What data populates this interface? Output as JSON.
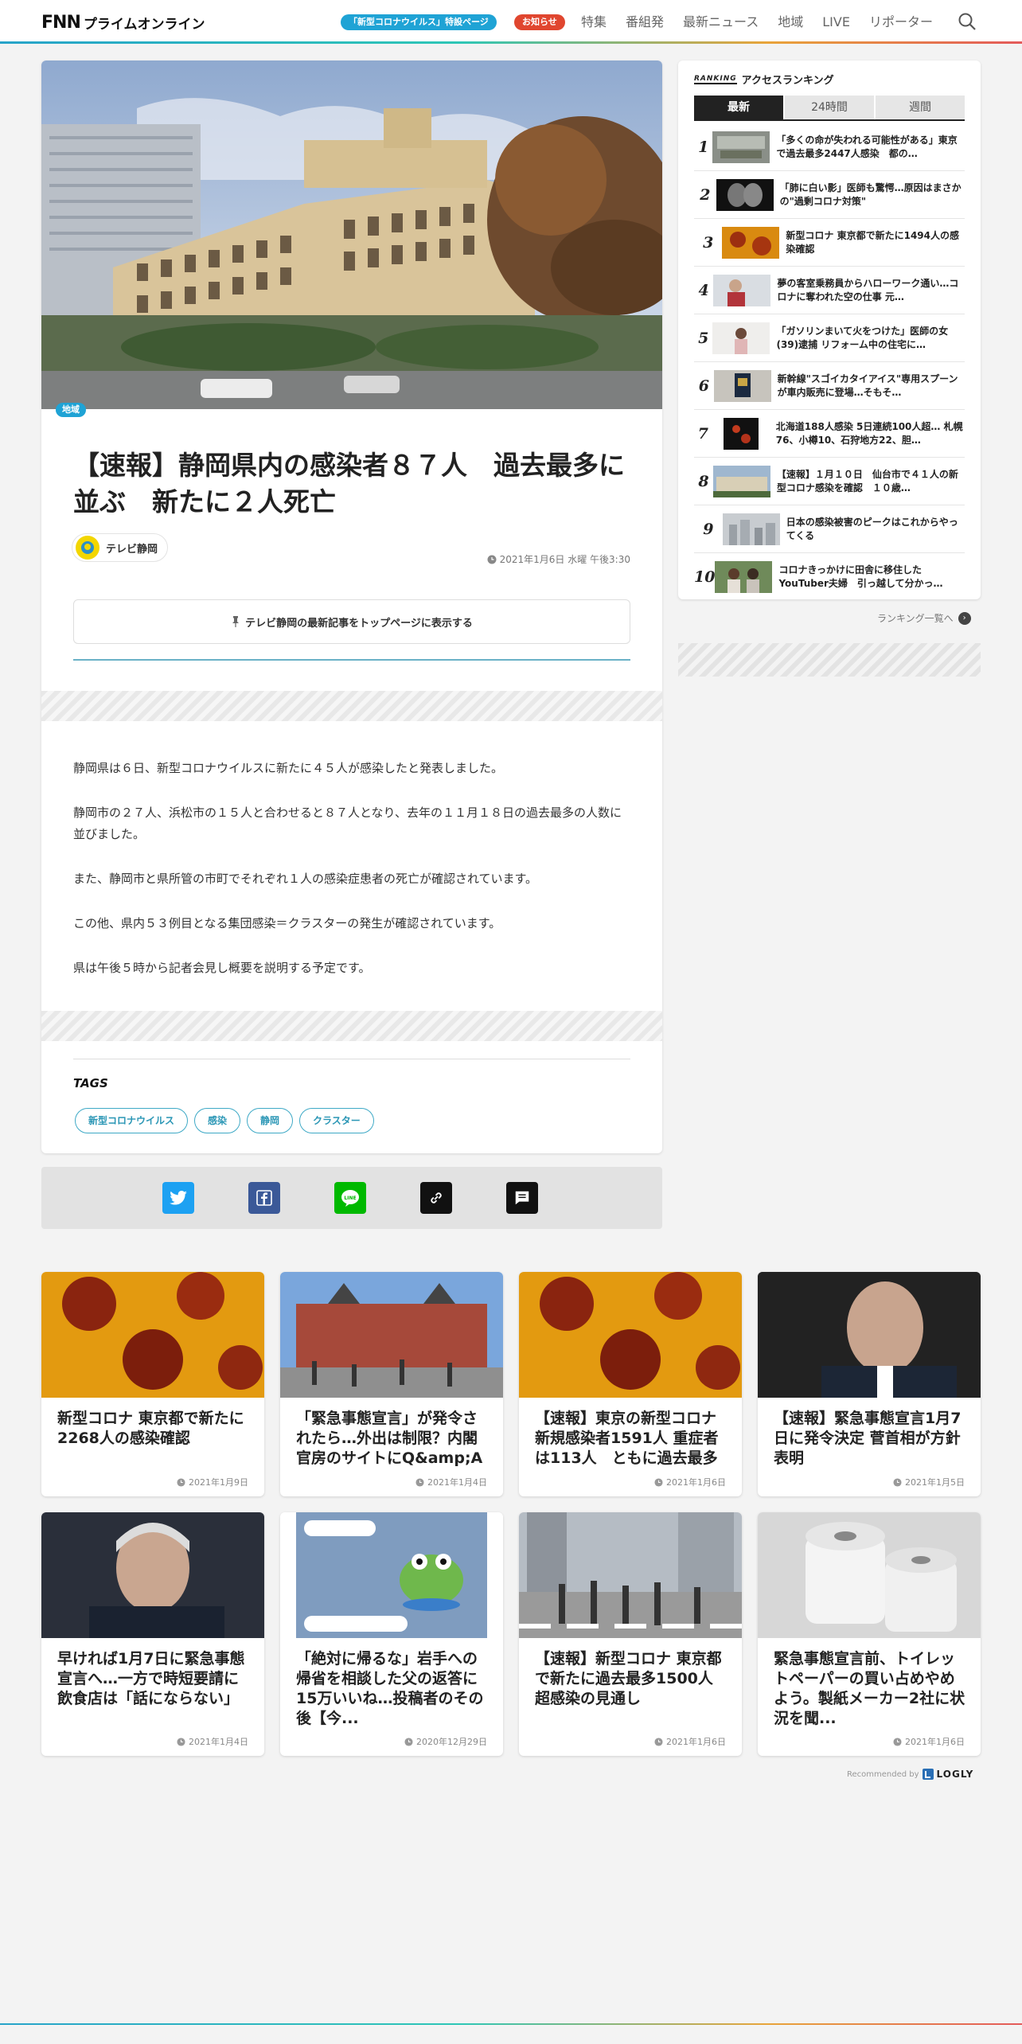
{
  "header": {
    "logo_fnn": "FNN",
    "logo_prime": "プライムオンライン",
    "corona_pill": "「新型コロナウイルス」特設ページ",
    "news_pill": "お知らせ",
    "nav": [
      "特集",
      "番組発",
      "最新ニュース",
      "地域",
      "LIVE",
      "リポーター"
    ]
  },
  "article": {
    "category": "地域",
    "title": "【速報】静岡県内の感染者８７人　過去最多に並ぶ　新たに２人死亡",
    "source": "テレビ静岡",
    "date": "2021年1月6日 水曜 午後3:30",
    "follow_label": "テレビ静岡の最新記事をトップページに表示する",
    "paragraphs": [
      "静岡県は６日、新型コロナウイルスに新たに４５人が感染したと発表しました。",
      "静岡市の２７人、浜松市の１５人と合わせると８７人となり、去年の１１月１８日の過去最多の人数に並びました。",
      "また、静岡市と県所管の市町でそれぞれ１人の感染症患者の死亡が確認されています。",
      "この他、県内５３例目となる集団感染＝クラスターの発生が確認されています。",
      "県は午後５時から記者会見し概要を説明する予定です。"
    ],
    "tags_title": "TAGS",
    "tags": [
      "新型コロナウイルス",
      "感染",
      "静岡",
      "クラスター"
    ]
  },
  "share": [
    "twitter-icon",
    "facebook-icon",
    "line-icon",
    "link-icon",
    "comment-icon"
  ],
  "ranking": {
    "badge": "RANKING",
    "title": "アクセスランキング",
    "tabs": [
      "最新",
      "24時間",
      "週間"
    ],
    "items": [
      {
        "num": "1",
        "text": "「多くの命が失われる可能性がある」東京で過去最多2447人感染　都の…"
      },
      {
        "num": "2",
        "text": "「肺に白い影」医師も驚愕…原因はまさかの\"過剰コロナ対策\""
      },
      {
        "num": "3",
        "text": "新型コロナ 東京都で新たに1494人の感染確認"
      },
      {
        "num": "4",
        "text": "夢の客室乗務員からハローワーク通い…コロナに奪われた空の仕事 元…"
      },
      {
        "num": "5",
        "text": "「ガソリンまいて火をつけた」医師の女(39)逮捕 リフォーム中の住宅に…"
      },
      {
        "num": "6",
        "text": "新幹線\"スゴイカタイアイス\"専用スプーンが車内販売に登場…そもそ…"
      },
      {
        "num": "7",
        "text": "北海道188人感染 5日連続100人超… 札幌76、小樽10、石狩地方22、胆…"
      },
      {
        "num": "8",
        "text": "【速報】１月１０日　仙台市で４１人の新型コロナ感染を確認　１０歳…"
      },
      {
        "num": "9",
        "text": "日本の感染被害のピークはこれからやってくる"
      },
      {
        "num": "10",
        "text": "コロナきっかけに田舎に移住した YouTuber夫婦　引っ越して分かっ…"
      }
    ],
    "more": "ランキング一覧へ"
  },
  "recommend": {
    "cards": [
      {
        "title": "新型コロナ 東京都で新たに2268人の感染確認",
        "date": "2021年1月9日"
      },
      {
        "title": "「緊急事態宣言」が発令されたら…外出は制限？内閣官房のサイトにQ&amp;A",
        "date": "2021年1月4日"
      },
      {
        "title": "【速報】東京の新型コロナ新規感染者1591人 重症者は113人　ともに過去最多",
        "date": "2021年1月6日"
      },
      {
        "title": "【速報】緊急事態宣言1月7日に発令決定 菅首相が方針表明",
        "date": "2021年1月5日"
      },
      {
        "title": "早ければ1月7日に緊急事態宣言へ…一方で時短要請に飲食店は「話にならない」",
        "date": "2021年1月4日"
      },
      {
        "title": "「絶対に帰るな」岩手への帰省を相談した父の返答に15万いいね…投稿者のその後【今...",
        "date": "2020年12月29日"
      },
      {
        "title": "【速報】新型コロナ 東京都で新たに過去最多1500人超感染の見通し",
        "date": "2021年1月6日"
      },
      {
        "title": "緊急事態宣言前、トイレットペーパーの買い占めやめよう。製紙メーカー2社に状況を聞...",
        "date": "2021年1月6日"
      }
    ],
    "recommended_by": "Recommended by",
    "logly": "LOGLY"
  },
  "colors": {
    "accent": "#1fa3d5",
    "alert": "#e0462f"
  }
}
